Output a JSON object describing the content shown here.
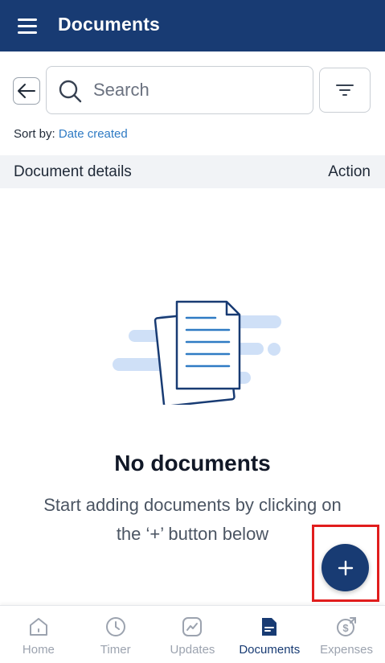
{
  "header": {
    "title": "Documents"
  },
  "search": {
    "placeholder": "Search"
  },
  "sort": {
    "label": "Sort by:",
    "value": "Date created"
  },
  "table": {
    "columns": [
      "Document details",
      "Action"
    ]
  },
  "empty_state": {
    "title": "No documents",
    "subtitle": "Start adding documents by clicking on the ‘+’ button below"
  },
  "fab": {
    "icon": "plus-icon"
  },
  "bottom_nav": {
    "items": [
      {
        "label": "Home",
        "icon": "home-icon",
        "active": false
      },
      {
        "label": "Timer",
        "icon": "clock-icon",
        "active": false
      },
      {
        "label": "Updates",
        "icon": "chart-line-icon",
        "active": false
      },
      {
        "label": "Documents",
        "icon": "document-icon",
        "active": true
      },
      {
        "label": "Expenses",
        "icon": "dollar-coin-icon",
        "active": false
      }
    ]
  },
  "colors": {
    "primary": "#183b73",
    "link": "#2f7bc4",
    "highlight": "#e11d1d",
    "inactive": "#9ca3af"
  }
}
